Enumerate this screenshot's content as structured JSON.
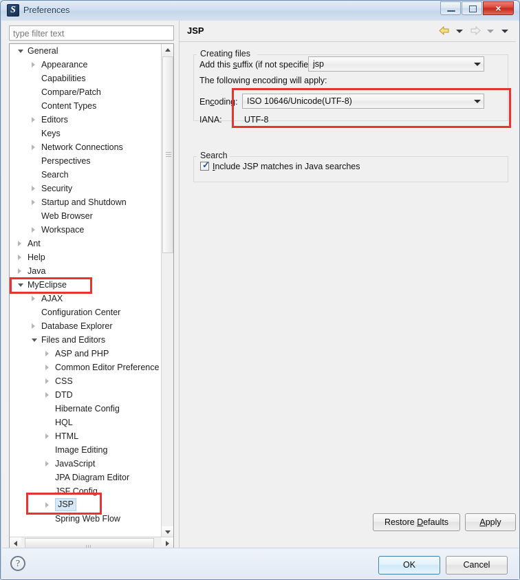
{
  "window": {
    "title": "Preferences",
    "icon": "myeclipse-logo-icon",
    "minimize_label": "Minimize",
    "maximize_label": "Maximize",
    "close_label": "×"
  },
  "filter": {
    "placeholder": "type filter text",
    "value": ""
  },
  "tree": {
    "items": [
      {
        "label": "General",
        "depth": 0,
        "state": "expanded"
      },
      {
        "label": "Appearance",
        "depth": 1,
        "state": "collapsed"
      },
      {
        "label": "Capabilities",
        "depth": 1,
        "state": "leaf"
      },
      {
        "label": "Compare/Patch",
        "depth": 1,
        "state": "leaf"
      },
      {
        "label": "Content Types",
        "depth": 1,
        "state": "leaf"
      },
      {
        "label": "Editors",
        "depth": 1,
        "state": "collapsed"
      },
      {
        "label": "Keys",
        "depth": 1,
        "state": "leaf"
      },
      {
        "label": "Network Connections",
        "depth": 1,
        "state": "collapsed"
      },
      {
        "label": "Perspectives",
        "depth": 1,
        "state": "leaf"
      },
      {
        "label": "Search",
        "depth": 1,
        "state": "leaf"
      },
      {
        "label": "Security",
        "depth": 1,
        "state": "collapsed"
      },
      {
        "label": "Startup and Shutdown",
        "depth": 1,
        "state": "collapsed"
      },
      {
        "label": "Web Browser",
        "depth": 1,
        "state": "leaf"
      },
      {
        "label": "Workspace",
        "depth": 1,
        "state": "collapsed"
      },
      {
        "label": "Ant",
        "depth": 0,
        "state": "collapsed"
      },
      {
        "label": "Help",
        "depth": 0,
        "state": "collapsed"
      },
      {
        "label": "Java",
        "depth": 0,
        "state": "collapsed"
      },
      {
        "label": "MyEclipse",
        "depth": 0,
        "state": "expanded",
        "highlight": true
      },
      {
        "label": "AJAX",
        "depth": 1,
        "state": "collapsed"
      },
      {
        "label": "Configuration Center",
        "depth": 1,
        "state": "leaf"
      },
      {
        "label": "Database Explorer",
        "depth": 1,
        "state": "collapsed"
      },
      {
        "label": "Files and Editors",
        "depth": 1,
        "state": "expanded"
      },
      {
        "label": "ASP and PHP",
        "depth": 2,
        "state": "collapsed"
      },
      {
        "label": "Common Editor Preference",
        "depth": 2,
        "state": "collapsed"
      },
      {
        "label": "CSS",
        "depth": 2,
        "state": "collapsed"
      },
      {
        "label": "DTD",
        "depth": 2,
        "state": "collapsed"
      },
      {
        "label": "Hibernate Config",
        "depth": 2,
        "state": "leaf"
      },
      {
        "label": "HQL",
        "depth": 2,
        "state": "leaf"
      },
      {
        "label": "HTML",
        "depth": 2,
        "state": "collapsed"
      },
      {
        "label": "Image Editing",
        "depth": 2,
        "state": "leaf"
      },
      {
        "label": "JavaScript",
        "depth": 2,
        "state": "collapsed"
      },
      {
        "label": "JPA Diagram Editor",
        "depth": 2,
        "state": "leaf"
      },
      {
        "label": "JSF Config",
        "depth": 2,
        "state": "leaf"
      },
      {
        "label": "JSP",
        "depth": 2,
        "state": "collapsed",
        "selected": true,
        "highlight": true
      },
      {
        "label": "Spring Web Flow",
        "depth": 2,
        "state": "leaf"
      }
    ]
  },
  "page": {
    "title": "JSP",
    "nav": {
      "back_icon": "back-arrow-icon",
      "back_menu_icon": "chevron-down-icon",
      "forward_icon": "forward-arrow-icon",
      "forward_menu_icon": "chevron-down-icon",
      "view_menu_icon": "chevron-down-icon"
    },
    "creating_files": {
      "group_label": "Creating files",
      "suffix_label_pre": "Add this ",
      "suffix_label_accel": "s",
      "suffix_label_post": "uffix (if not specified):",
      "suffix_value": "jsp",
      "encoding_note": "The following encoding will apply:",
      "encoding_label_pre": "En",
      "encoding_label_accel": "c",
      "encoding_label_post": "oding:",
      "encoding_value": "ISO 10646/Unicode(UTF-8)",
      "iana_label": "IANA:",
      "iana_value": "UTF-8"
    },
    "search": {
      "group_label": "Search",
      "checkbox_label_pre": "",
      "checkbox_label_accel": "I",
      "checkbox_label_post": "nclude JSP matches in Java searches",
      "checkbox_checked": true,
      "check_glyph": "✓"
    }
  },
  "buttons": {
    "restore_defaults_pre": "Restore ",
    "restore_defaults_accel": "D",
    "restore_defaults_post": "efaults",
    "apply_pre": "",
    "apply_accel": "A",
    "apply_post": "pply",
    "ok": "OK",
    "cancel": "Cancel",
    "help_glyph": "?"
  },
  "colors": {
    "annotation_red": "#e8332e",
    "selection_blue": "#d6e8f7",
    "primary_border": "#3c7fb1",
    "titlebar_close": "#c2291d"
  }
}
